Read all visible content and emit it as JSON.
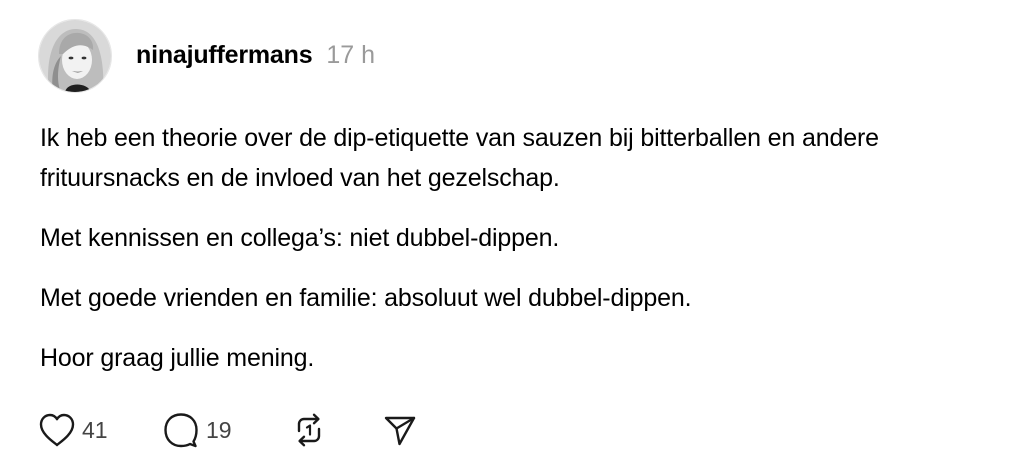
{
  "post": {
    "author": {
      "username": "ninajuffermans",
      "timestamp": "17 h"
    },
    "paragraphs": [
      "Ik heb een theorie over de dip-etiquette van sauzen bij bitterballen en andere frituursnacks en de invloed van het gezelschap.",
      "Met kennissen en collega’s: niet dubbel-dippen.",
      "Met goede vrienden en familie: absoluut wel dubbel-dippen.",
      "Hoor graag jullie mening."
    ],
    "actions": {
      "like": {
        "icon": "heart-icon",
        "count": "41"
      },
      "reply": {
        "icon": "comment-icon",
        "count": "19"
      },
      "repost": {
        "icon": "repost-icon"
      },
      "share": {
        "icon": "send-icon"
      }
    }
  }
}
